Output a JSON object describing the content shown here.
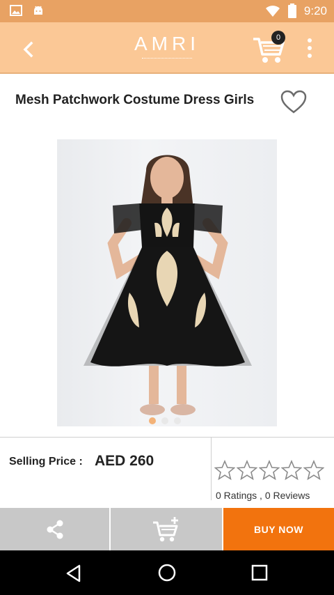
{
  "status_bar": {
    "time": "9:20",
    "icons": [
      "image-icon",
      "android-icon",
      "wifi-icon",
      "battery-icon"
    ],
    "color": "#e8a263"
  },
  "app_bar": {
    "logo": "AMRI",
    "cart_count": "0",
    "icons": [
      "back-arrow-icon",
      "cart-icon",
      "more-vert-icon"
    ],
    "color": "#fbc896"
  },
  "product": {
    "title": "Mesh Patchwork Costume Dress Girls",
    "image_alt": "girl wearing black mesh dress with gold patchwork",
    "carousel": {
      "count": 3,
      "active": 0
    }
  },
  "pricing": {
    "label": "Selling Price :",
    "value": "AED 260",
    "rating": 0,
    "rating_max": 5,
    "ratings_text": "0 Ratings , 0 Reviews"
  },
  "actions": {
    "buy_now": "BUY NOW",
    "buy_now_color": "#f2730e",
    "icons": [
      "share-icon",
      "add-to-cart-icon"
    ]
  },
  "nav": {
    "icons": [
      "nav-back-icon",
      "nav-home-icon",
      "nav-recent-icon"
    ]
  }
}
